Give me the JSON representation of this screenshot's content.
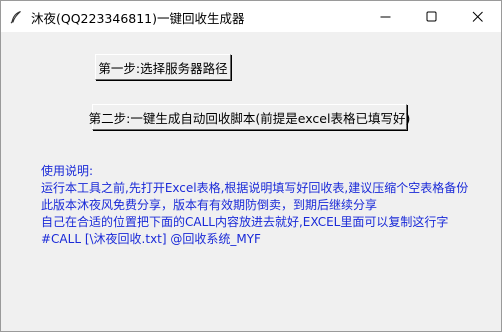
{
  "window": {
    "title": "沐夜(QQ223346811)一键回收生成器",
    "app_icon": "feather-icon",
    "controls": [
      "minimize-icon",
      "maximize-icon",
      "close-icon"
    ]
  },
  "buttons": {
    "step1_label": "第一步:选择服务器路径",
    "step2_label": "第二步:一键生成自动回收脚本(前提是excel表格已填写好)"
  },
  "instructions": {
    "lines": [
      "使用说明:",
      "运行本工具之前,先打开Excel表格,根据说明填写好回收表,建议压缩个空表格备份",
      "此版本沐夜风免费分享，版本有有效期防倒卖，到期后继续分享",
      "自己在合适的位置把下面的CALL内容放进去就好,EXCEL里面可以复制这行字",
      "#CALL [\\沐夜回收.txt] @回收系统_MYF"
    ],
    "text_color": "#1a2ad8"
  }
}
